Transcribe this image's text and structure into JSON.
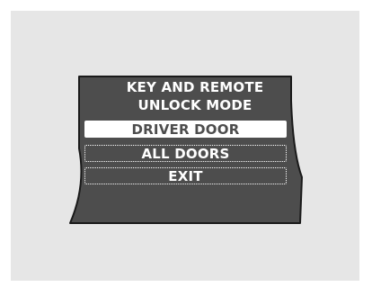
{
  "screen": {
    "title_line1": "KEY AND REMOTE",
    "title_line2": "UNLOCK MODE"
  },
  "menu": {
    "items": [
      {
        "label": "DRIVER DOOR",
        "selected": true
      },
      {
        "label": "ALL DOORS",
        "selected": false
      },
      {
        "label": "EXIT",
        "selected": false
      }
    ]
  },
  "colors": {
    "panel_background": "#e6e6e6",
    "display_fill": "#4d4d4d",
    "display_border": "#1a1a1a",
    "text": "#ffffff",
    "highlight": "#ffffff"
  }
}
